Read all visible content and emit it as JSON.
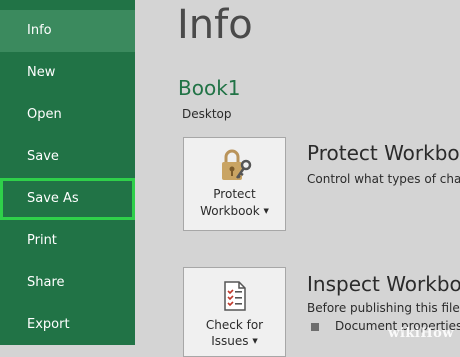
{
  "sidebar": {
    "items": [
      {
        "label": "Info",
        "active": true
      },
      {
        "label": "New"
      },
      {
        "label": "Open"
      },
      {
        "label": "Save"
      },
      {
        "label": "Save As",
        "highlighted": true
      },
      {
        "label": "Print"
      },
      {
        "label": "Share"
      },
      {
        "label": "Export"
      }
    ]
  },
  "main": {
    "title": "Info",
    "workbook_name": "Book1",
    "location": "Desktop",
    "protect": {
      "button_line1": "Protect",
      "button_line2": "Workbook",
      "title": "Protect Workboo",
      "description": "Control what types of cha"
    },
    "inspect": {
      "button_line1": "Check for",
      "button_line2": "Issues",
      "title": "Inspect Workboo",
      "description": "Before publishing this file,",
      "bullet": "Document properties"
    }
  },
  "watermark": "wikiHow",
  "colors": {
    "sidebar_bg": "#217346",
    "active_item_bg": "#3b8a5e",
    "highlight_outline": "#2fd04a",
    "main_bg": "#d4d4d4",
    "accent_text": "#217346"
  },
  "icons": {
    "protect": "lock-key-icon",
    "inspect": "document-checklist-icon"
  }
}
